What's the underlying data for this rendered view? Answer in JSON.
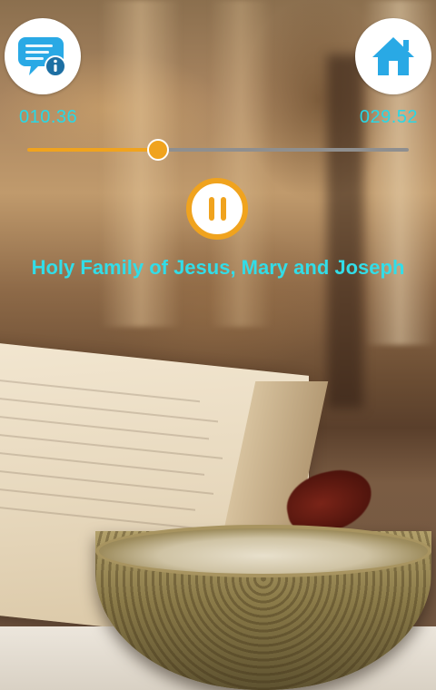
{
  "player": {
    "current_time": "010.36",
    "total_time": "029.52",
    "progress_fraction": 0.344,
    "track_title": "Holy Family of Jesus, Mary and Joseph"
  },
  "buttons": {
    "info_icon": "chat-info-icon",
    "home_icon": "home-icon",
    "pause_icon": "pause-icon"
  },
  "colors": {
    "accent_cyan": "#28d8e6",
    "accent_orange": "#f0a31e",
    "icon_blue": "#29a9e5"
  }
}
